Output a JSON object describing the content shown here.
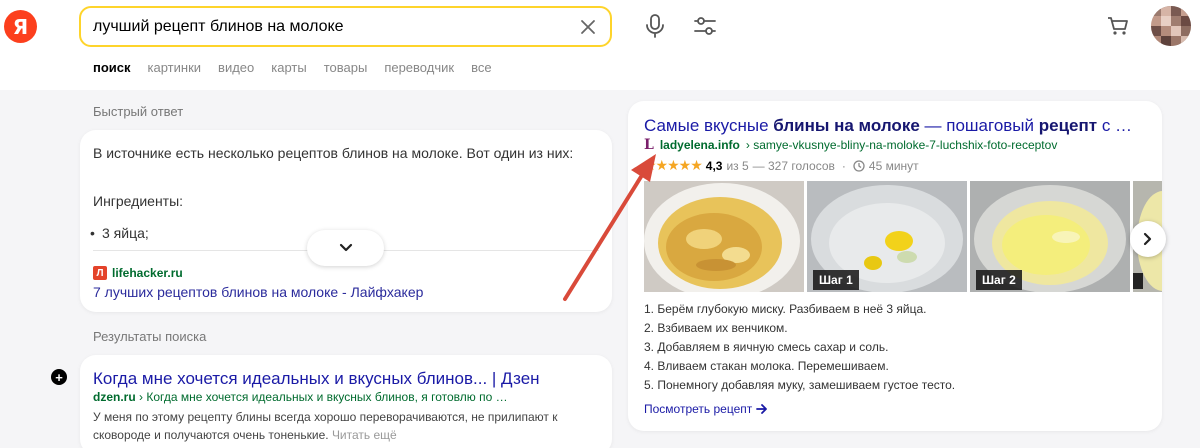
{
  "logo": {
    "letter": "Я"
  },
  "search": {
    "value": "лучший рецепт блинов на молоке"
  },
  "tabs": [
    {
      "label": "поиск"
    },
    {
      "label": "картинки"
    },
    {
      "label": "видео"
    },
    {
      "label": "карты"
    },
    {
      "label": "товары"
    },
    {
      "label": "переводчик"
    },
    {
      "label": "все"
    }
  ],
  "quick_answer": {
    "section_label": "Быстрый ответ",
    "text": "В источнике есть несколько рецептов блинов на молоке. Вот один из них:",
    "ingredients_label": "Ингредиенты:",
    "item": "3 яйца;",
    "source_favicon": "Л",
    "source_domain": "lifehacker.ru",
    "source_link": "7 лучших рецептов блинов на молоке - Лайфхакер"
  },
  "results": {
    "section_label": "Результаты поиска",
    "plus": "+",
    "title": "Когда мне хочется идеальных и вкусных блинов... | Дзен",
    "url_domain": "dzen.ru",
    "url_rest": " › Когда мне хочется идеальных и вкусных блинов, я готовлю по …",
    "snippet": "У меня по этому рецепту блины всегда хорошо переворачиваются, не прилипают к сковороде и получаются очень тоненькие. ",
    "read_more": "Читать ещё"
  },
  "recipe": {
    "title_1": "Самые вкусные ",
    "title_b1": "блины на молоке",
    "title_2": " — пошаговый ",
    "title_b2": "рецепт",
    "title_3": " с …",
    "site_logo": "L",
    "domain": "ladyelena.info",
    "path": "› samye-vkusnye-bliny-na-moloke-7-luchshix-foto-receptov",
    "stars": "★★★★★",
    "rating_value": 4.3,
    "score": "4,3",
    "of": "из 5",
    "votes": "— 327 голосов",
    "time": "45 минут",
    "step_labels": [
      "Шаг 1",
      "Шаг 2"
    ],
    "steps": [
      "1. Берём глубокую миску. Разбиваем в неё 3 яйца.",
      "2. Взбиваем их венчиком.",
      "3. Добавляем в яичную смесь сахар и соль.",
      "4. Вливаем стакан молока. Перемешиваем.",
      "5. Понемногу добавляя муку, замешиваем густое тесто."
    ],
    "more": "Посмотреть рецепт"
  },
  "colors": {
    "accent": "#fc3f1d",
    "search_border": "#fed42b",
    "link": "#1a1aa6",
    "url": "#006b2e",
    "annotation": "#d94a3a"
  }
}
